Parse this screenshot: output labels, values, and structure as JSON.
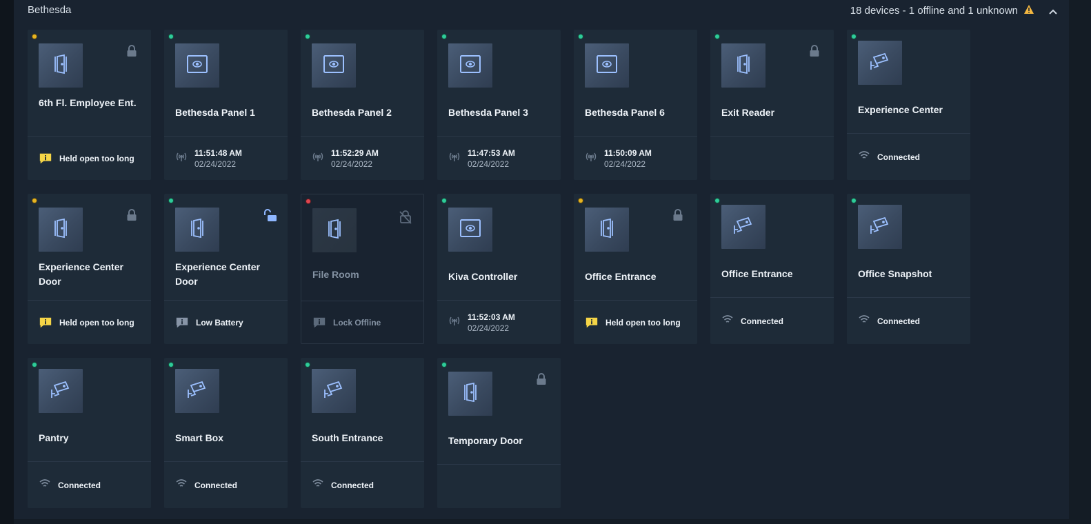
{
  "site": {
    "title": "Bethesda",
    "summary": "18 devices - 1 offline and 1 unknown"
  },
  "colors": {
    "accent": "#8fb7ff",
    "status_online": "#2ecc9a",
    "status_warning": "#e6b422",
    "status_offline": "#e0454f",
    "alert_yellow": "#f5d547"
  },
  "devices": [
    {
      "name": "6th Fl. Employee Ent.",
      "type": "door",
      "status": "yellow",
      "lock": "locked",
      "footer": {
        "kind": "alert",
        "text": "Held open too long"
      }
    },
    {
      "name": "Bethesda Panel 1",
      "type": "panel",
      "status": "green",
      "footer": {
        "kind": "time",
        "time": "11:51:48 AM",
        "date": "02/24/2022"
      }
    },
    {
      "name": "Bethesda Panel 2",
      "type": "panel",
      "status": "green",
      "footer": {
        "kind": "time",
        "time": "11:52:29 AM",
        "date": "02/24/2022"
      }
    },
    {
      "name": "Bethesda Panel 3",
      "type": "panel",
      "status": "green",
      "footer": {
        "kind": "time",
        "time": "11:47:53 AM",
        "date": "02/24/2022"
      }
    },
    {
      "name": "Bethesda Panel 6",
      "type": "panel",
      "status": "green",
      "footer": {
        "kind": "time",
        "time": "11:50:09 AM",
        "date": "02/24/2022"
      }
    },
    {
      "name": "Exit Reader",
      "type": "door",
      "status": "green",
      "lock": "locked",
      "footer": {
        "kind": "empty"
      }
    },
    {
      "name": "Experience Center",
      "type": "camera",
      "status": "green",
      "footer": {
        "kind": "wifi",
        "text": "Connected"
      }
    },
    {
      "name": "Experience Center Door",
      "type": "door",
      "status": "yellow",
      "lock": "locked",
      "footer": {
        "kind": "alert",
        "text": "Held open too long"
      }
    },
    {
      "name": "Experience Center Door",
      "type": "door",
      "status": "green",
      "lock": "unlocked",
      "footer": {
        "kind": "info",
        "text": "Low Battery"
      }
    },
    {
      "name": "File Room",
      "type": "door",
      "status": "red",
      "lock": "offline",
      "offline": true,
      "footer": {
        "kind": "info",
        "text": "Lock Offline"
      }
    },
    {
      "name": "Kiva Controller",
      "type": "panel",
      "status": "green",
      "footer": {
        "kind": "time",
        "time": "11:52:03 AM",
        "date": "02/24/2022"
      }
    },
    {
      "name": "Office Entrance",
      "type": "door",
      "status": "yellow",
      "lock": "locked",
      "footer": {
        "kind": "alert",
        "text": "Held open too long"
      }
    },
    {
      "name": "Office Entrance",
      "type": "camera",
      "status": "green",
      "footer": {
        "kind": "wifi",
        "text": "Connected"
      }
    },
    {
      "name": "Office Snapshot",
      "type": "camera",
      "status": "green",
      "footer": {
        "kind": "wifi",
        "text": "Connected"
      }
    },
    {
      "name": "Pantry",
      "type": "camera",
      "status": "green",
      "footer": {
        "kind": "wifi",
        "text": "Connected"
      }
    },
    {
      "name": "Smart Box",
      "type": "camera",
      "status": "green",
      "footer": {
        "kind": "wifi",
        "text": "Connected"
      }
    },
    {
      "name": "South Entrance",
      "type": "camera",
      "status": "green",
      "footer": {
        "kind": "wifi",
        "text": "Connected"
      }
    },
    {
      "name": "Temporary Door",
      "type": "door",
      "status": "green",
      "lock": "locked",
      "footer": {
        "kind": "empty"
      }
    }
  ]
}
